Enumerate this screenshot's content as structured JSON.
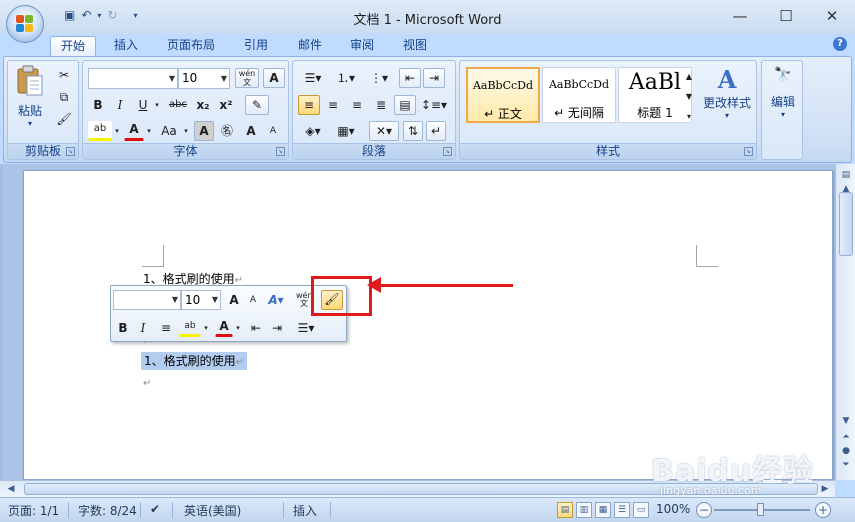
{
  "window": {
    "title": "文档 1 - Microsoft Word",
    "controls": [
      "—",
      "☐",
      "✕"
    ]
  },
  "qat": {
    "undo_glyph": "↶",
    "redo_glyph": "↻",
    "save_glyph": "▣",
    "more_glyph": "▾"
  },
  "tabs": [
    {
      "label": "开始"
    },
    {
      "label": "插入"
    },
    {
      "label": "页面布局"
    },
    {
      "label": "引用"
    },
    {
      "label": "邮件"
    },
    {
      "label": "审阅"
    },
    {
      "label": "视图"
    }
  ],
  "ribbon": {
    "clipboard": {
      "paste_label": "粘贴",
      "group_label": "剪贴板"
    },
    "font": {
      "font_name": "",
      "font_size": "10",
      "group_label": "字体",
      "pinyin_glyph": "wén",
      "bold": "B",
      "italic": "I",
      "underline": "U",
      "strike": "abc",
      "subscript": "x₂",
      "superscript": "x²",
      "grow": "A",
      "shrink": "A",
      "case": "Aa",
      "charshade": "A",
      "enclose": "字",
      "highlight": "ab",
      "fontcolor": "A"
    },
    "paragraph": {
      "group_label": "段落"
    },
    "styles": {
      "group_label": "样式",
      "items": [
        {
          "sample": "AaBbCcDd",
          "name": "↵ 正文"
        },
        {
          "sample": "AaBbCcDd",
          "name": "↵ 无间隔"
        },
        {
          "sample": "AaBl",
          "name": "标题 1"
        }
      ],
      "change_styles_label": "更改样式"
    },
    "editing": {
      "label": "编辑"
    }
  },
  "document": {
    "line1": "1、格式刷的使用",
    "line2": "1、格式刷的使用",
    "para_mark": "↵"
  },
  "mini_toolbar": {
    "font_name": "",
    "font_size": "10",
    "grow": "A",
    "shrink": "A",
    "bold": "B",
    "italic": "I",
    "center": "≡",
    "highlight": "ab",
    "fontcolor": "A"
  },
  "status": {
    "page": "页面: 1/1",
    "words": "字数: 8/24",
    "language": "英语(美国)",
    "insert_mode": "插入",
    "zoom": "100%"
  },
  "watermark": {
    "brand": "Baidu经验",
    "url": "jingyan.baidu.com"
  },
  "colors": {
    "accent": "#15428b",
    "highlight_box": "#e0191b",
    "selection": "#b3cdf0"
  }
}
